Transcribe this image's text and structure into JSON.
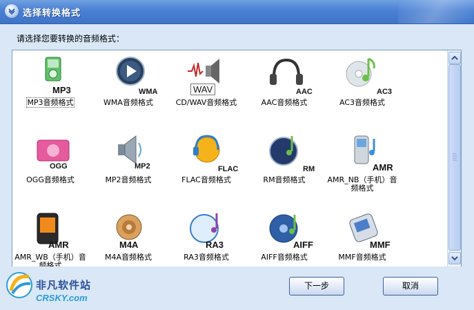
{
  "window": {
    "title": "选择转换格式"
  },
  "prompt": "请选择您要转换的音频格式：",
  "formats": [
    {
      "id": "mp3",
      "badge": "MP3",
      "caption": "MP3音频格式"
    },
    {
      "id": "wma",
      "badge": "WMA",
      "caption": "WMA音频格式"
    },
    {
      "id": "wav",
      "badge": "WAV",
      "caption": "CD/WAV音频格式"
    },
    {
      "id": "aac",
      "badge": "AAC",
      "caption": "AAC音频格式"
    },
    {
      "id": "ac3",
      "badge": "AC3",
      "caption": "AC3音频格式"
    },
    {
      "id": "ogg",
      "badge": "OGG",
      "caption": "OGG音频格式"
    },
    {
      "id": "mp2",
      "badge": "MP2",
      "caption": "MP2音频格式"
    },
    {
      "id": "flac",
      "badge": "FLAC",
      "caption": "FLAC音频格式"
    },
    {
      "id": "rm",
      "badge": "RM",
      "caption": "RM音频格式"
    },
    {
      "id": "amrnb",
      "badge": "AMR",
      "caption": "AMR_NB（手机）音频格式"
    },
    {
      "id": "amrwb",
      "badge": "AMR",
      "caption": "AMR_WB（手机）音频格式"
    },
    {
      "id": "m4a",
      "badge": "M4A",
      "caption": "M4A音频格式"
    },
    {
      "id": "ra3",
      "badge": "RA3",
      "caption": "RA3音频格式"
    },
    {
      "id": "aiff",
      "badge": "AIFF",
      "caption": "AIFF音频格式"
    },
    {
      "id": "mmf",
      "badge": "MMF",
      "caption": "MMF音频格式"
    }
  ],
  "buttons": {
    "next": "下一步",
    "cancel": "取消"
  },
  "logo": {
    "cn": "非凡软件站",
    "en": "CRSKY.com"
  },
  "colors": {
    "title_bar": "#4a80d3",
    "panel_border": "#7f9db9",
    "background": "#d9e7f6"
  }
}
